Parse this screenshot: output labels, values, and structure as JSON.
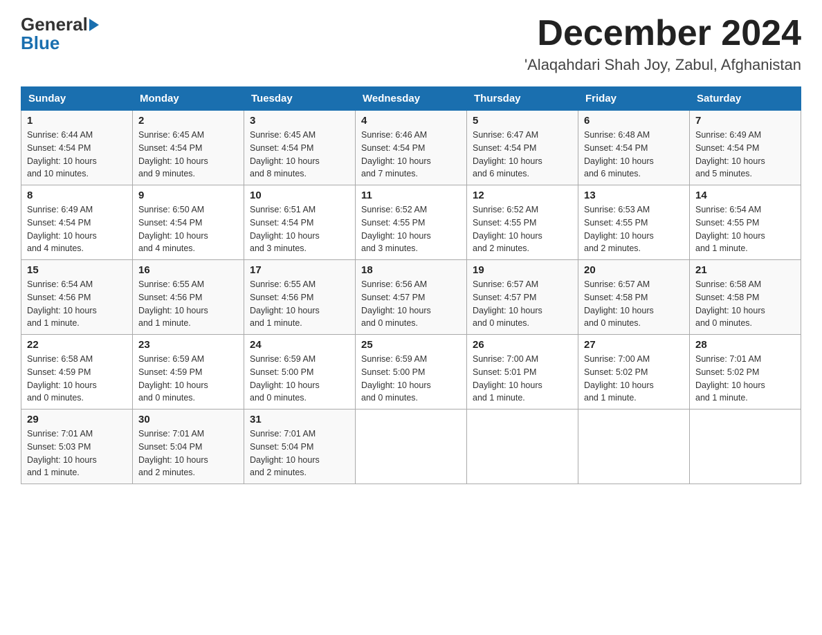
{
  "header": {
    "logo_general": "General",
    "logo_blue": "Blue",
    "month_title": "December 2024",
    "location": "'Alaqahdari Shah Joy, Zabul, Afghanistan"
  },
  "weekdays": [
    "Sunday",
    "Monday",
    "Tuesday",
    "Wednesday",
    "Thursday",
    "Friday",
    "Saturday"
  ],
  "weeks": [
    [
      {
        "day": "1",
        "sunrise": "6:44 AM",
        "sunset": "4:54 PM",
        "daylight": "10 hours and 10 minutes."
      },
      {
        "day": "2",
        "sunrise": "6:45 AM",
        "sunset": "4:54 PM",
        "daylight": "10 hours and 9 minutes."
      },
      {
        "day": "3",
        "sunrise": "6:45 AM",
        "sunset": "4:54 PM",
        "daylight": "10 hours and 8 minutes."
      },
      {
        "day": "4",
        "sunrise": "6:46 AM",
        "sunset": "4:54 PM",
        "daylight": "10 hours and 7 minutes."
      },
      {
        "day": "5",
        "sunrise": "6:47 AM",
        "sunset": "4:54 PM",
        "daylight": "10 hours and 6 minutes."
      },
      {
        "day": "6",
        "sunrise": "6:48 AM",
        "sunset": "4:54 PM",
        "daylight": "10 hours and 6 minutes."
      },
      {
        "day": "7",
        "sunrise": "6:49 AM",
        "sunset": "4:54 PM",
        "daylight": "10 hours and 5 minutes."
      }
    ],
    [
      {
        "day": "8",
        "sunrise": "6:49 AM",
        "sunset": "4:54 PM",
        "daylight": "10 hours and 4 minutes."
      },
      {
        "day": "9",
        "sunrise": "6:50 AM",
        "sunset": "4:54 PM",
        "daylight": "10 hours and 4 minutes."
      },
      {
        "day": "10",
        "sunrise": "6:51 AM",
        "sunset": "4:54 PM",
        "daylight": "10 hours and 3 minutes."
      },
      {
        "day": "11",
        "sunrise": "6:52 AM",
        "sunset": "4:55 PM",
        "daylight": "10 hours and 3 minutes."
      },
      {
        "day": "12",
        "sunrise": "6:52 AM",
        "sunset": "4:55 PM",
        "daylight": "10 hours and 2 minutes."
      },
      {
        "day": "13",
        "sunrise": "6:53 AM",
        "sunset": "4:55 PM",
        "daylight": "10 hours and 2 minutes."
      },
      {
        "day": "14",
        "sunrise": "6:54 AM",
        "sunset": "4:55 PM",
        "daylight": "10 hours and 1 minute."
      }
    ],
    [
      {
        "day": "15",
        "sunrise": "6:54 AM",
        "sunset": "4:56 PM",
        "daylight": "10 hours and 1 minute."
      },
      {
        "day": "16",
        "sunrise": "6:55 AM",
        "sunset": "4:56 PM",
        "daylight": "10 hours and 1 minute."
      },
      {
        "day": "17",
        "sunrise": "6:55 AM",
        "sunset": "4:56 PM",
        "daylight": "10 hours and 1 minute."
      },
      {
        "day": "18",
        "sunrise": "6:56 AM",
        "sunset": "4:57 PM",
        "daylight": "10 hours and 0 minutes."
      },
      {
        "day": "19",
        "sunrise": "6:57 AM",
        "sunset": "4:57 PM",
        "daylight": "10 hours and 0 minutes."
      },
      {
        "day": "20",
        "sunrise": "6:57 AM",
        "sunset": "4:58 PM",
        "daylight": "10 hours and 0 minutes."
      },
      {
        "day": "21",
        "sunrise": "6:58 AM",
        "sunset": "4:58 PM",
        "daylight": "10 hours and 0 minutes."
      }
    ],
    [
      {
        "day": "22",
        "sunrise": "6:58 AM",
        "sunset": "4:59 PM",
        "daylight": "10 hours and 0 minutes."
      },
      {
        "day": "23",
        "sunrise": "6:59 AM",
        "sunset": "4:59 PM",
        "daylight": "10 hours and 0 minutes."
      },
      {
        "day": "24",
        "sunrise": "6:59 AM",
        "sunset": "5:00 PM",
        "daylight": "10 hours and 0 minutes."
      },
      {
        "day": "25",
        "sunrise": "6:59 AM",
        "sunset": "5:00 PM",
        "daylight": "10 hours and 0 minutes."
      },
      {
        "day": "26",
        "sunrise": "7:00 AM",
        "sunset": "5:01 PM",
        "daylight": "10 hours and 1 minute."
      },
      {
        "day": "27",
        "sunrise": "7:00 AM",
        "sunset": "5:02 PM",
        "daylight": "10 hours and 1 minute."
      },
      {
        "day": "28",
        "sunrise": "7:01 AM",
        "sunset": "5:02 PM",
        "daylight": "10 hours and 1 minute."
      }
    ],
    [
      {
        "day": "29",
        "sunrise": "7:01 AM",
        "sunset": "5:03 PM",
        "daylight": "10 hours and 1 minute."
      },
      {
        "day": "30",
        "sunrise": "7:01 AM",
        "sunset": "5:04 PM",
        "daylight": "10 hours and 2 minutes."
      },
      {
        "day": "31",
        "sunrise": "7:01 AM",
        "sunset": "5:04 PM",
        "daylight": "10 hours and 2 minutes."
      },
      null,
      null,
      null,
      null
    ]
  ],
  "labels": {
    "sunrise": "Sunrise:",
    "sunset": "Sunset:",
    "daylight": "Daylight:"
  }
}
